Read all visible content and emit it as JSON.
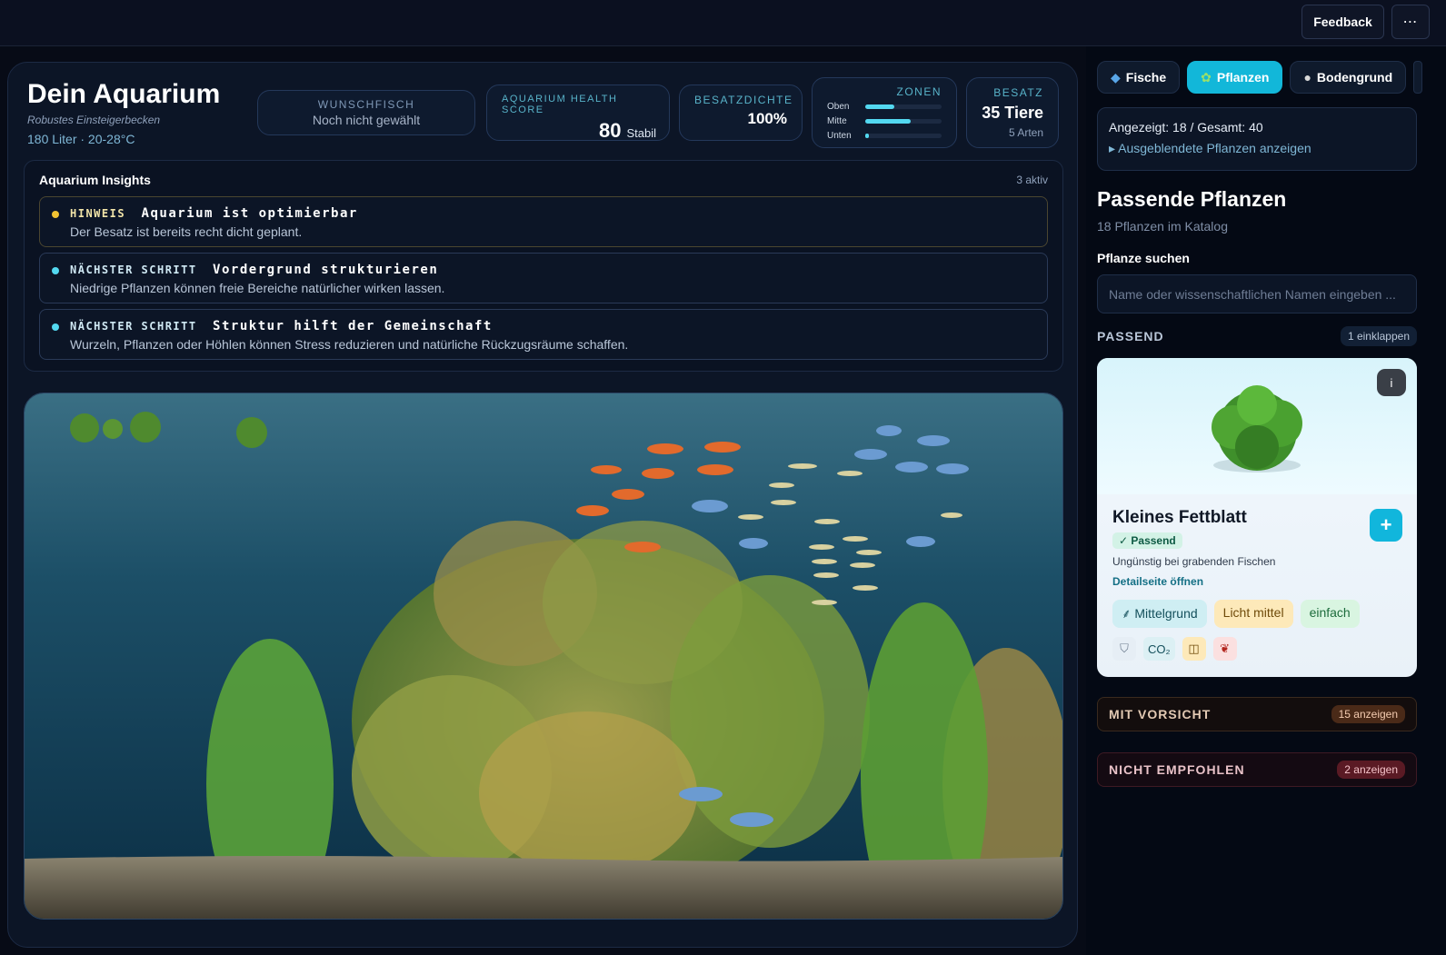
{
  "topbar": {
    "feedback_label": "Feedback",
    "more_label": "⋯"
  },
  "aquarium": {
    "title": "Dein Aquarium",
    "subtitle": "Robustes Einsteigerbecken",
    "meta": "180 Liter · 20-28°C"
  },
  "stats": {
    "wish_label": "Wunschfisch",
    "wish_value": "Noch nicht gewählt",
    "health_label": "Aquarium Health Score",
    "health_value": "80",
    "health_sub": "Stabil",
    "density_label": "Besatzdichte",
    "density_value": "100%",
    "zones_label": "Zonen",
    "zones": [
      {
        "label": "Oben",
        "level": 0.38
      },
      {
        "label": "Mitte",
        "level": 0.6
      },
      {
        "label": "Unten",
        "level": 0.05
      }
    ],
    "besatz_label": "Besatz",
    "besatz_value": "35 Tiere",
    "besatz_sub": "5 Arten"
  },
  "insights": {
    "title": "Aquarium Insights",
    "count": "3 aktiv",
    "items": [
      {
        "tag": "HINWEIS",
        "head": "Aquarium ist optimierbar",
        "text": "Der Besatz ist bereits recht dicht geplant.",
        "color": "#f1c232"
      },
      {
        "tag": "NÄCHSTER SCHRITT",
        "head": "Vordergrund strukturieren",
        "text": "Niedrige Pflanzen können freie Bereiche natürlicher wirken lassen.",
        "color": "#53d8f0"
      },
      {
        "tag": "NÄCHSTER SCHRITT",
        "head": "Struktur hilft der Gemeinschaft",
        "text": "Wurzeln, Pflanzen oder Höhlen können Stress reduzieren und natürliche Rückzugsräume schaffen.",
        "color": "#53d8f0"
      }
    ]
  },
  "sidebar": {
    "tabs": [
      {
        "label": "Fische",
        "icon": "fish-icon"
      },
      {
        "label": "Pflanzen",
        "icon": "plant-icon"
      },
      {
        "label": "Bodengrund",
        "icon": "rock-icon"
      }
    ],
    "count_text": "Angezeigt: 18 / Gesamt: 40",
    "hidden_toggle": "▸ Ausgeblendete Pflanzen anzeigen",
    "title": "Passende Pflanzen",
    "subtitle": "18 Pflanzen im Katalog",
    "search_label": "Pflanze suchen",
    "search_placeholder": "Name oder wissenschaftlichen Namen eingeben ...",
    "section_passend": "PASSEND",
    "collapse_label": "1 einklappen",
    "card": {
      "info": "i",
      "name": "Kleines Fettblatt",
      "badge": "✓ Passend",
      "note": "Ungünstig bei grabenden Fischen",
      "link": "Detailseite öffnen",
      "add": "+",
      "chip_zone": "Mittelgrund",
      "chip_light": "Licht mittel",
      "chip_difficulty": "einfach",
      "co2": "CO₂"
    },
    "caution_title": "MIT VORSICHT",
    "caution_badge": "15 anzeigen",
    "bad_title": "NICHT EMPFOHLEN",
    "bad_badge": "2 anzeigen"
  }
}
